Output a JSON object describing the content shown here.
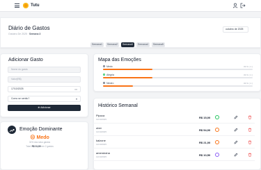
{
  "app": {
    "title": "Tutu"
  },
  "header": {
    "title": "Diário de Gastos",
    "subtitle_prefix": "Outubro De 2025 ·",
    "subtitle_week": "Semana 3",
    "date": "outubro de 2025",
    "tabs": [
      "Semana1",
      "Semana2",
      "Semana3",
      "Semana4",
      "Semana5"
    ],
    "active_tab": 2
  },
  "add_expense": {
    "title": "Adicionar Gasto",
    "name_placeholder": "Nome do gasto",
    "value_placeholder": "Valor(R$)",
    "date_value": "17/10/2025",
    "feeling_placeholder": "Como se sentiu?",
    "button_label": "Adicionar"
  },
  "dominant": {
    "title": "Emoção Dominante",
    "emotion": "Medo",
    "caption": "31% dos seus gastos",
    "total_prefix": "Total:",
    "total_value": "R$ 31,80",
    "total_suffix": "em 2 gastos"
  },
  "emotions": {
    "title": "Mapa das Emoções",
    "items": [
      {
        "name": "Medo",
        "pct_label": "33 % ( 1 )",
        "fill": 0.33
      },
      {
        "name": "Alegria",
        "pct_label": "33 % ( 1 )",
        "fill": 0.33
      },
      {
        "name": "Neutro",
        "pct_label": "33 % ( 1 )",
        "fill": 0.2
      }
    ]
  },
  "history": {
    "title": "Histórico Semanal",
    "rows": [
      {
        "item": "Pipoca",
        "date": "12/10/2025",
        "amount": "R$ 15,00",
        "emotion_color": "#22c55e"
      },
      {
        "item": "uber",
        "date": "12/10/2025",
        "amount": "R$ 54,00",
        "emotion_color": "#f97316"
      },
      {
        "item": "kalzone",
        "date": "12/10/2025",
        "amount": "R$ 21,00",
        "emotion_color": "#f97316"
      },
      {
        "item": "amendoina",
        "date": "12/10/2025",
        "amount": "R$ 10,50",
        "emotion_color": "#8b5cf6"
      }
    ]
  },
  "colors": {
    "accent": "#f97316",
    "dark": "#1f2937",
    "danger": "#ef4444"
  }
}
